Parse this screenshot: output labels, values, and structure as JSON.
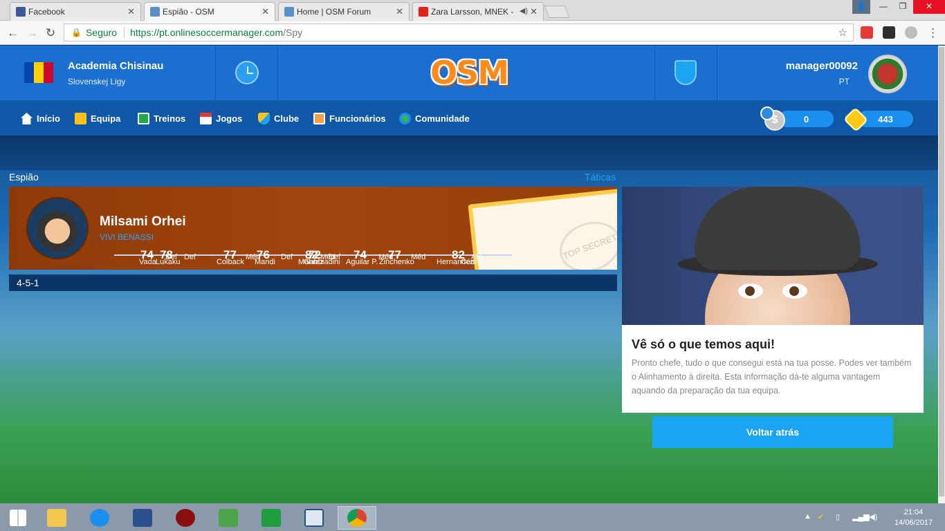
{
  "browser": {
    "tabs": [
      {
        "label": "Facebook",
        "active": false
      },
      {
        "label": "Espião - OSM",
        "active": true
      },
      {
        "label": "Home | OSM Forum",
        "active": false
      },
      {
        "label": "Zara Larsson, MNEK -",
        "active": false
      }
    ],
    "secure_label": "Seguro",
    "url_host": "https://pt.onlinesoccermanager.com",
    "url_path": "/Spy"
  },
  "header": {
    "club_name": "Academia Chisinau",
    "league": "Slovenskej Ligy",
    "logo_text": "OSM",
    "manager_name": "manager00092",
    "manager_country": "PT"
  },
  "nav": {
    "items": [
      "Início",
      "Equipa",
      "Treinos",
      "Jogos",
      "Clube",
      "Funcionários",
      "Comunidade"
    ],
    "coins": "0",
    "boss_coins": "443"
  },
  "spy": {
    "title": "Espião",
    "tactics_link": "Táticas",
    "opponent_team": "Milsami Orhei",
    "opponent_coach": "VIVI BENASSI",
    "players": {
      "numbers": [
        "74",
        "78",
        "77",
        "76",
        "82",
        "72",
        "74",
        "77",
        "82"
      ],
      "names": [
        "Vada",
        "Lukaku",
        "Colback",
        "Mandi",
        "Mahrez",
        "Gabbiadini",
        "Aguilar P.",
        "Zinchenko",
        "Hernandez",
        "Cédric"
      ],
      "positions": [
        "Def",
        "Def",
        "Méd",
        "Def",
        "Méd",
        "Def",
        "Méd",
        "Méd",
        "Ata"
      ]
    },
    "formation": "4-5-1"
  },
  "right_panel": {
    "title": "Vê só o que temos aqui!",
    "text": "Pronto chefe, tudo o que consegui está na tua posse. Podes ver também o Alinhamento à direita. Esta informação dá-te alguma vantagem aquando da preparação da tua equipa.",
    "button": "Voltar atrás",
    "stamp_text": "TOP SECRET"
  },
  "taskbar": {
    "time": "21:04",
    "date": "14/06/2017"
  },
  "colors": {
    "accent": "#1ba4f1",
    "header_blue": "#1b6fd1",
    "card_brown": "#a2440d"
  }
}
